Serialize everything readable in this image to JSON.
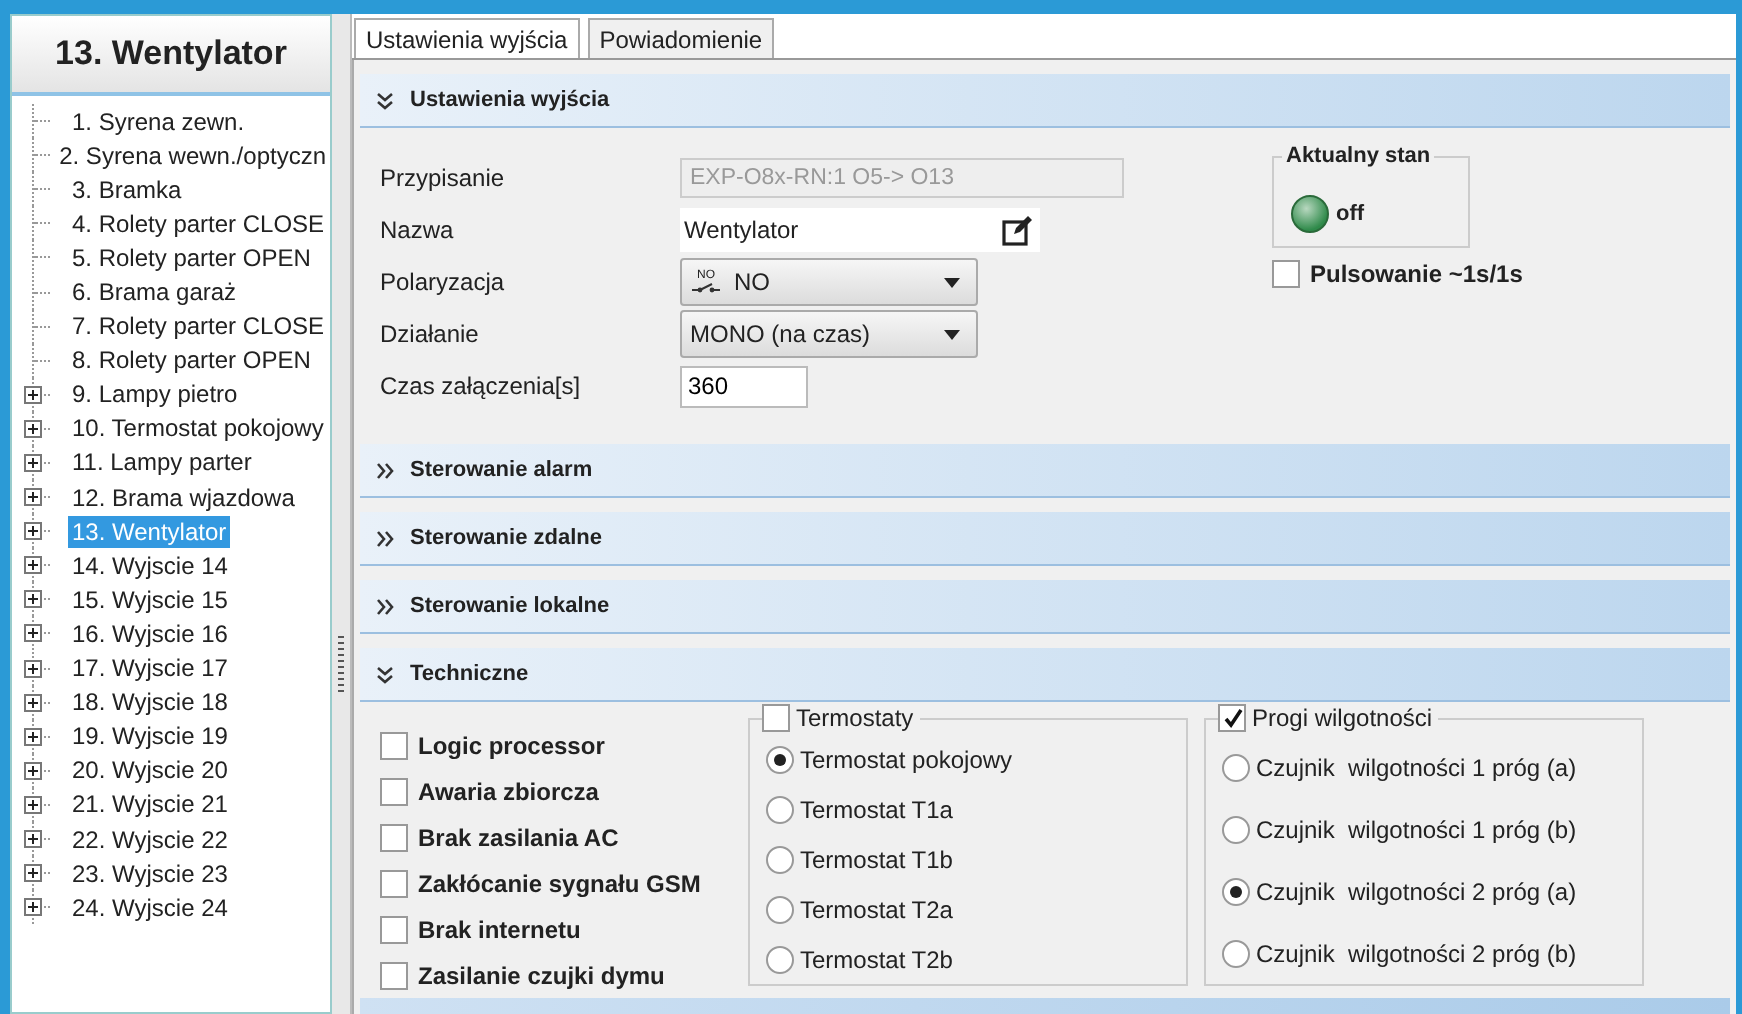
{
  "sidebar": {
    "title": "13. Wentylator",
    "items": [
      {
        "label": "1. Syrena zewn.",
        "kind": "leaf",
        "selected": false
      },
      {
        "label": "2. Syrena wewn./optyczn",
        "kind": "leaf",
        "selected": false
      },
      {
        "label": "3. Bramka",
        "kind": "leaf",
        "selected": false
      },
      {
        "label": "4. Rolety parter CLOSE",
        "kind": "leaf",
        "selected": false
      },
      {
        "label": "5. Rolety parter OPEN",
        "kind": "leaf",
        "selected": false
      },
      {
        "label": "6. Brama garaż",
        "kind": "leaf",
        "selected": false
      },
      {
        "label": "7. Rolety parter CLOSE",
        "kind": "leaf",
        "selected": false
      },
      {
        "label": "8. Rolety parter OPEN",
        "kind": "leaf",
        "selected": false
      },
      {
        "label": "9. Lampy pietro",
        "kind": "folder",
        "expanded": false,
        "selected": false
      },
      {
        "label": "10. Termostat pokojowy",
        "kind": "folder",
        "expanded": false,
        "selected": false
      },
      {
        "label": "11. Lampy parter",
        "kind": "folder",
        "expanded": false,
        "selected": false
      },
      {
        "label": "12. Brama wjazdowa",
        "kind": "folder",
        "expanded": false,
        "selected": false
      },
      {
        "label": "13. Wentylator",
        "kind": "folder",
        "expanded": false,
        "selected": true
      },
      {
        "label": "14. Wyjscie 14",
        "kind": "folder",
        "expanded": false,
        "selected": false
      },
      {
        "label": "15. Wyjscie 15",
        "kind": "folder",
        "expanded": false,
        "selected": false
      },
      {
        "label": "16. Wyjscie 16",
        "kind": "folder",
        "expanded": false,
        "selected": false
      },
      {
        "label": "17. Wyjscie 17",
        "kind": "folder",
        "expanded": false,
        "selected": false
      },
      {
        "label": "18. Wyjscie 18",
        "kind": "folder",
        "expanded": false,
        "selected": false
      },
      {
        "label": "19. Wyjscie 19",
        "kind": "folder",
        "expanded": false,
        "selected": false
      },
      {
        "label": "20. Wyjscie 20",
        "kind": "folder",
        "expanded": false,
        "selected": false
      },
      {
        "label": "21. Wyjscie 21",
        "kind": "folder",
        "expanded": false,
        "selected": false
      },
      {
        "label": "22. Wyjscie 22",
        "kind": "folder",
        "expanded": false,
        "selected": false
      },
      {
        "label": "23. Wyjscie 23",
        "kind": "folder",
        "expanded": false,
        "selected": false
      },
      {
        "label": "24. Wyjscie 24",
        "kind": "folder",
        "expanded": false,
        "selected": false
      }
    ]
  },
  "tabs": [
    {
      "label": "Ustawienia wyjścia",
      "selected": true
    },
    {
      "label": "Powiadomienie",
      "selected": false
    }
  ],
  "sections": [
    {
      "kind": "output",
      "title": "Ustawienia wyjścia",
      "expanded": true,
      "fields": [
        {
          "kind": "readonly",
          "label": "Przypisanie",
          "value": "EXP-O8x-RN:1 O5-> O13"
        },
        {
          "kind": "edit",
          "label": "Nazwa",
          "value": "Wentylator"
        },
        {
          "kind": "dropdown",
          "label": "Polaryzacja",
          "value": "NO",
          "icon_label": "NO"
        },
        {
          "kind": "dropdown",
          "label": "Działanie",
          "value": "MONO (na czas)"
        },
        {
          "kind": "input",
          "label": "Czas załączenia[s]",
          "value": "360"
        }
      ],
      "status": {
        "title": "Aktualny stan",
        "state": "off",
        "on": false
      },
      "pulse": {
        "label": "Pulsowanie ~1s/1s",
        "checked": false
      }
    },
    {
      "kind": "collapsed",
      "title": "Sterowanie alarm",
      "expanded": false
    },
    {
      "kind": "collapsed",
      "title": "Sterowanie zdalne",
      "expanded": false
    },
    {
      "kind": "collapsed",
      "title": "Sterowanie lokalne",
      "expanded": false
    },
    {
      "kind": "technical",
      "title": "Techniczne",
      "expanded": true,
      "checks": [
        {
          "label": "Logic processor",
          "checked": false
        },
        {
          "label": "Awaria zbiorcza",
          "checked": false
        },
        {
          "label": "Brak zasilania AC",
          "checked": false
        },
        {
          "label": "Zakłócanie sygnału GSM",
          "checked": false
        },
        {
          "label": "Brak internetu",
          "checked": false
        },
        {
          "label": "Zasilanie czujki dymu",
          "checked": false
        }
      ],
      "groups": [
        {
          "title": "Termostaty",
          "checked": false,
          "options": [
            {
              "label": "Termostat pokojowy",
              "selected": true
            },
            {
              "label": "Termostat T1a",
              "selected": false
            },
            {
              "label": "Termostat T1b",
              "selected": false
            },
            {
              "label": "Termostat T2a",
              "selected": false
            },
            {
              "label": "Termostat T2b",
              "selected": false
            }
          ]
        },
        {
          "title": "Progi wilgotności",
          "checked": true,
          "options": [
            {
              "label": "Czujnik  wilgotności 1 próg (a)",
              "selected": false
            },
            {
              "label": "Czujnik  wilgotności 1 próg (b)",
              "selected": false
            },
            {
              "label": "Czujnik  wilgotności 2 próg (a)",
              "selected": true
            },
            {
              "label": "Czujnik  wilgotności 2 próg (b)",
              "selected": false
            }
          ]
        }
      ]
    }
  ]
}
